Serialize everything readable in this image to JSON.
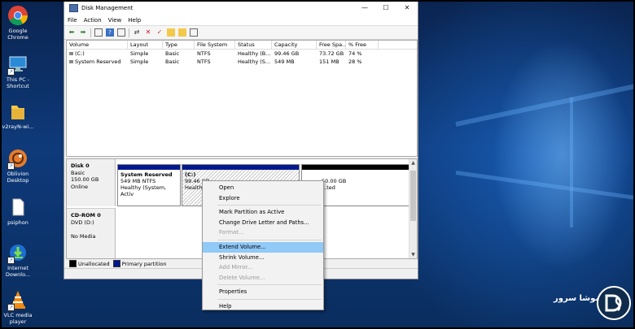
{
  "desktop_icons": [
    {
      "name": "google-chrome-icon",
      "label": "Google Chrome"
    },
    {
      "name": "this-pc-icon",
      "label": "This PC - Shortcut"
    },
    {
      "name": "folder-icon",
      "label": "v2rayN-wi..."
    },
    {
      "name": "oblivion-icon",
      "label": "Oblivion Desktop"
    },
    {
      "name": "psiphon-icon",
      "label": "psiphon"
    },
    {
      "name": "internet-download-icon",
      "label": "Internet Downlo..."
    },
    {
      "name": "vlc-icon",
      "label": "VLC media player"
    }
  ],
  "window": {
    "title": "Disk Management",
    "menu": [
      "File",
      "Action",
      "View",
      "Help"
    ],
    "toolbar_icons": [
      "back-icon",
      "forward-icon",
      "console-tree-icon",
      "help-icon",
      "properties-icon",
      "connect-icon",
      "delete-icon",
      "check-icon",
      "new-volume-icon",
      "open-icon",
      "explore-icon"
    ]
  },
  "volume_list": {
    "columns": [
      "Volume",
      "Layout",
      "Type",
      "File System",
      "Status",
      "Capacity",
      "Free Spa...",
      "% Free"
    ],
    "rows": [
      [
        "(C:)",
        "Simple",
        "Basic",
        "NTFS",
        "Healthy (B...",
        "99.46 GB",
        "73.72 GB",
        "74 %"
      ],
      [
        "System Reserved",
        "Simple",
        "Basic",
        "NTFS",
        "Healthy (S...",
        "549 MB",
        "151 MB",
        "28 %"
      ]
    ]
  },
  "disks": [
    {
      "name": "Disk 0",
      "type": "Basic",
      "size": "150.00 GB",
      "state": "Online",
      "partitions": [
        {
          "title": "System Reserved",
          "size": "549 MB NTFS",
          "status": "Healthy (System, Activ"
        },
        {
          "title": "(C:)",
          "size": "99.46 GB",
          "status": "Healthy"
        },
        {
          "title": "",
          "size": "50.00 GB",
          "status": "...ted"
        }
      ]
    },
    {
      "name": "CD-ROM 0",
      "type": "DVD (D:)",
      "size": "",
      "state": "No Media"
    }
  ],
  "legend": [
    {
      "label": "Unallocated",
      "color": "#000000"
    },
    {
      "label": "Primary partition",
      "color": "#02188f"
    }
  ],
  "context_menu": {
    "items": [
      {
        "label": "Open",
        "enabled": true
      },
      {
        "label": "Explore",
        "enabled": true
      },
      {
        "sep": true
      },
      {
        "label": "Mark Partition as Active",
        "enabled": true
      },
      {
        "label": "Change Drive Letter and Paths...",
        "enabled": true
      },
      {
        "label": "Format...",
        "enabled": false
      },
      {
        "sep": true
      },
      {
        "label": "Extend Volume...",
        "enabled": true,
        "highlighted": true
      },
      {
        "label": "Shrink Volume...",
        "enabled": true
      },
      {
        "label": "Add Mirror...",
        "enabled": false
      },
      {
        "label": "Delete Volume...",
        "enabled": false
      },
      {
        "sep": true
      },
      {
        "label": "Properties",
        "enabled": true
      },
      {
        "sep": true
      },
      {
        "label": "Help",
        "enabled": true
      }
    ]
  },
  "watermark": {
    "text": "موشا سرور"
  }
}
